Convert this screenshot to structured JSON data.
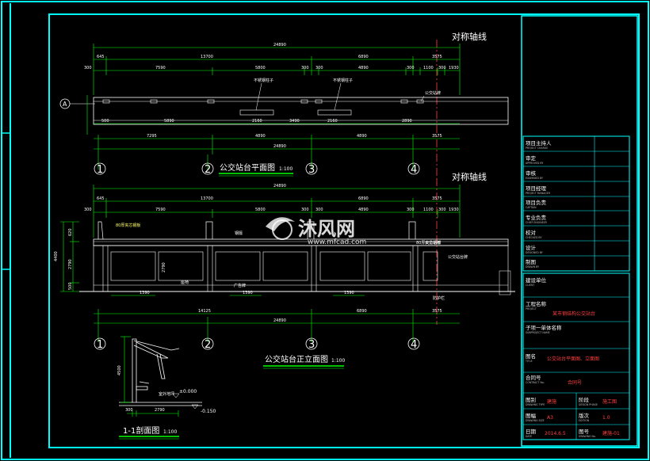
{
  "plan": {
    "title": "公交站台平面图",
    "scale": "1:100",
    "axis_label": "对称轴线",
    "row_axis": "A",
    "overall_dim": "24890",
    "bottom_overall": "24890",
    "top_dims": [
      "645",
      "13700",
      "6890",
      "3575"
    ],
    "second_dims": [
      "300",
      "7590",
      "5800",
      "300",
      "300",
      "4890",
      "300",
      "1100",
      "300",
      "1930"
    ],
    "inner_dims": [
      "500",
      "5890",
      "2160",
      "3490",
      "2160",
      "2890"
    ],
    "bottom_dims": [
      "7295",
      "4890",
      "4890",
      "3575"
    ],
    "annotations": [
      "不锈钢柱子",
      "不锈钢柱子",
      "公交站牌"
    ],
    "axes": [
      "1",
      "2",
      "3",
      "4"
    ]
  },
  "elevation": {
    "title": "公交站台正立面图",
    "scale": "1:100",
    "axis_label": "对称轴线",
    "overall_dim": "24890",
    "bottom_overall": "24890",
    "top_dims": [
      "645",
      "13700",
      "6890",
      "3575"
    ],
    "second_dims": [
      "300",
      "7590",
      "5800",
      "300",
      "300",
      "4890",
      "300",
      "1100",
      "300",
      "1930"
    ],
    "left_dims": [
      "4400",
      "2790",
      "500",
      "620"
    ],
    "inner_dims": [
      "1390",
      "2790",
      "1390",
      "1390"
    ],
    "bottom_dims": [
      "14125",
      "6890",
      "3575"
    ],
    "annotations": [
      "80厚夹芯钢板",
      "钢檩",
      "公交站牌",
      "公交站台牌",
      "座椅",
      "广告牌",
      "防护栏",
      "80厚夹芯钢板"
    ],
    "axes": [
      "1",
      "2",
      "3",
      "4"
    ]
  },
  "section": {
    "title": "1-1剖面图",
    "scale": "1:100",
    "dims": [
      "4500",
      "300",
      "2790"
    ],
    "level_label": "室外地坪",
    "level_top": "±0.000",
    "level_bottom": "-0.150"
  },
  "watermark": {
    "brand": "沐风网",
    "url": "www.mfcad.com"
  },
  "title_block": {
    "rows": [
      {
        "label": "项目主持人",
        "sub": "PROJECT CHARGE"
      },
      {
        "label": "审定",
        "sub": "APPROVED BY"
      },
      {
        "label": "审核",
        "sub": "EXAMINED BY"
      },
      {
        "label": "项目经理",
        "sub": "PROJECT MANAGER"
      },
      {
        "label": "项目负责",
        "sub": "CAPTAIN"
      },
      {
        "label": "专业负责",
        "sub": "CHIEF ENGINEER"
      },
      {
        "label": "校对",
        "sub": "CHECKED BY"
      },
      {
        "label": "设计",
        "sub": "DESIGNED BY"
      },
      {
        "label": "制图",
        "sub": "DRAWN BY"
      }
    ],
    "client_label": "建设单位",
    "client_sub": "CLIENT",
    "project_label": "工程名称",
    "project_sub": "PROJECT",
    "project_value": "某市钢结构公交站台",
    "sub_label": "子项一单体名称",
    "sub_sub": "SUBPROJECT NAME",
    "drawing_label": "图名",
    "drawing_sub": "TITLE",
    "drawing_value": "公交站台平面图、立面图",
    "contract_label": "合同号",
    "contract_sub": "CONTRACT No.",
    "contract_value": "合同号",
    "cat_label": "图别",
    "cat_sub": "DRAWING TYPE",
    "cat_value": "建施",
    "stage_label": "阶段",
    "stage_sub": "DESIGN PHASE",
    "stage_value": "施工图",
    "size_label": "图幅",
    "size_sub": "DRAWING SIZE",
    "size_value": "A3",
    "ver_label": "版次",
    "ver_sub": "EDITION",
    "ver_value": "1.0",
    "date_label": "日期",
    "date_sub": "DATE",
    "date_value": "2014.6.5",
    "no_label": "图号",
    "no_sub": "DRAWING No.",
    "no_value": "建施-01"
  },
  "colors": {
    "frame": "#00ffff",
    "dim": "#00ff00",
    "body": "#ffffff",
    "accent": "#ff3333",
    "tag": "#ffff00"
  }
}
